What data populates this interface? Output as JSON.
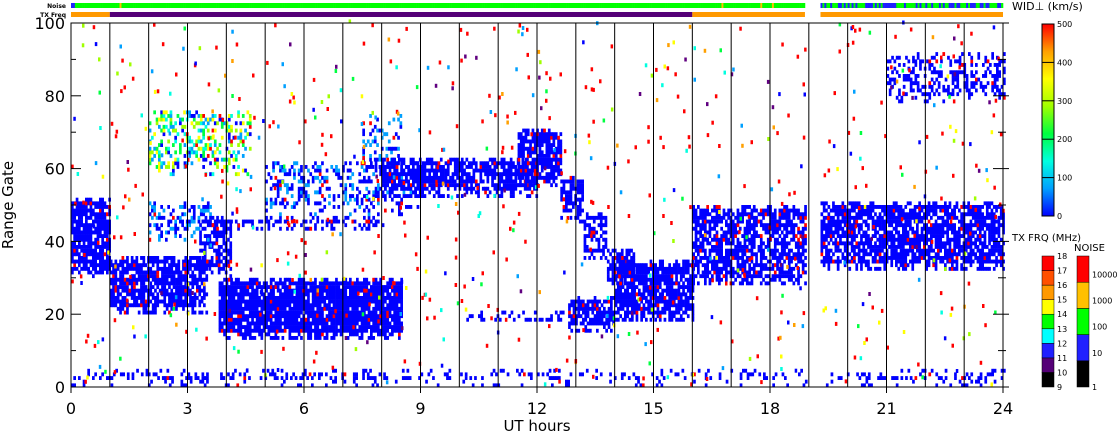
{
  "chart_data": {
    "type": "heatmap",
    "xlabel": "UT hours",
    "ylabel": "Range Gate",
    "xlim": [
      0,
      24
    ],
    "ylim": [
      0,
      100
    ],
    "xticks": [
      "0",
      "3",
      "6",
      "9",
      "12",
      "15",
      "18",
      "21",
      "24"
    ],
    "yticks": [
      "0",
      "20",
      "40",
      "60",
      "80",
      "100"
    ],
    "data_gap_hours": [
      18.9,
      19.3
    ],
    "colorbar": {
      "title": "WID⊥ (km/s)",
      "range": [
        0,
        500
      ],
      "ticks": [
        "0",
        "100",
        "200",
        "300",
        "400",
        "500"
      ],
      "colors": [
        "#0000ff",
        "#00a0ff",
        "#00ffe0",
        "#00ff40",
        "#a0ff00",
        "#ffff00",
        "#ffa000",
        "#ff0000"
      ]
    },
    "txfreq_legend": {
      "title": "TX FRQ (MHz)",
      "ticks": [
        "9",
        "10",
        "11",
        "12",
        "13",
        "14",
        "15",
        "16",
        "17",
        "18"
      ],
      "colors": [
        "#000000",
        "#550077",
        "#2020ff",
        "#00ffff",
        "#00ff00",
        "#ffff00",
        "#ff9900",
        "#ff5000",
        "#ff0000"
      ]
    },
    "noise_legend": {
      "title": "NOISE",
      "ticks": [
        "1",
        "10",
        "100",
        "1000",
        "10000"
      ],
      "colors": [
        "#000000",
        "#2020ff",
        "#00ff00",
        "#ffc000",
        "#ff0000"
      ]
    },
    "status_rows": {
      "noise_label": "Noise",
      "txfreq_label": "TX Freq",
      "txfreq_segments": [
        {
          "from": 0,
          "to": 1,
          "mhz": 15
        },
        {
          "from": 1,
          "to": 16,
          "mhz": 10
        },
        {
          "from": 16,
          "to": 18.9,
          "mhz": 15
        },
        {
          "from": 19.3,
          "to": 24,
          "mhz": 15
        }
      ]
    },
    "echo_regions": [
      {
        "t": [
          0,
          1
        ],
        "g": [
          30,
          52
        ],
        "d": 0.8,
        "w": 30
      },
      {
        "t": [
          1,
          3.5
        ],
        "g": [
          20,
          36
        ],
        "d": 0.8,
        "w": 40
      },
      {
        "t": [
          3.3,
          4.1
        ],
        "g": [
          30,
          46
        ],
        "d": 0.6,
        "w": 40
      },
      {
        "t": [
          2,
          3.6
        ],
        "g": [
          40,
          51
        ],
        "d": 0.35,
        "w": 80
      },
      {
        "t": [
          2,
          4.6
        ],
        "g": [
          58,
          76
        ],
        "d": 0.35,
        "w": 250
      },
      {
        "t": [
          3.8,
          8.5
        ],
        "g": [
          13,
          30
        ],
        "d": 0.9,
        "w": 30
      },
      {
        "t": [
          3.5,
          8
        ],
        "g": [
          43,
          47
        ],
        "d": 0.5,
        "w": 40
      },
      {
        "t": [
          5,
          9
        ],
        "g": [
          47,
          62
        ],
        "d": 0.35,
        "w": 60
      },
      {
        "t": [
          7.5,
          8.5
        ],
        "g": [
          60,
          75
        ],
        "d": 0.25,
        "w": 80
      },
      {
        "t": [
          8,
          12
        ],
        "g": [
          52,
          63
        ],
        "d": 0.75,
        "w": 40
      },
      {
        "t": [
          11.5,
          12.6
        ],
        "g": [
          55,
          71
        ],
        "d": 0.75,
        "w": 30
      },
      {
        "t": [
          12.6,
          13.2
        ],
        "g": [
          45,
          58
        ],
        "d": 0.6,
        "w": 20
      },
      {
        "t": [
          13.2,
          13.8
        ],
        "g": [
          35,
          48
        ],
        "d": 0.6,
        "w": 20
      },
      {
        "t": [
          13.8,
          14.5
        ],
        "g": [
          28,
          38
        ],
        "d": 0.6,
        "w": 20
      },
      {
        "t": [
          14,
          16
        ],
        "g": [
          18,
          35
        ],
        "d": 0.8,
        "w": 20
      },
      {
        "t": [
          12.8,
          14
        ],
        "g": [
          15,
          25
        ],
        "d": 0.75,
        "w": 30
      },
      {
        "t": [
          10,
          12.7
        ],
        "g": [
          18,
          21
        ],
        "d": 0.35,
        "w": 30
      },
      {
        "t": [
          16,
          18.9
        ],
        "g": [
          28,
          50
        ],
        "d": 0.7,
        "w": 20
      },
      {
        "t": [
          19.3,
          24
        ],
        "g": [
          32,
          51
        ],
        "d": 0.75,
        "w": 30
      },
      {
        "t": [
          21,
          24
        ],
        "g": [
          78,
          92
        ],
        "d": 0.4,
        "w": 30
      },
      {
        "t": [
          0,
          24
        ],
        "g": [
          0,
          5
        ],
        "d": 0.25,
        "w": 30
      }
    ]
  }
}
